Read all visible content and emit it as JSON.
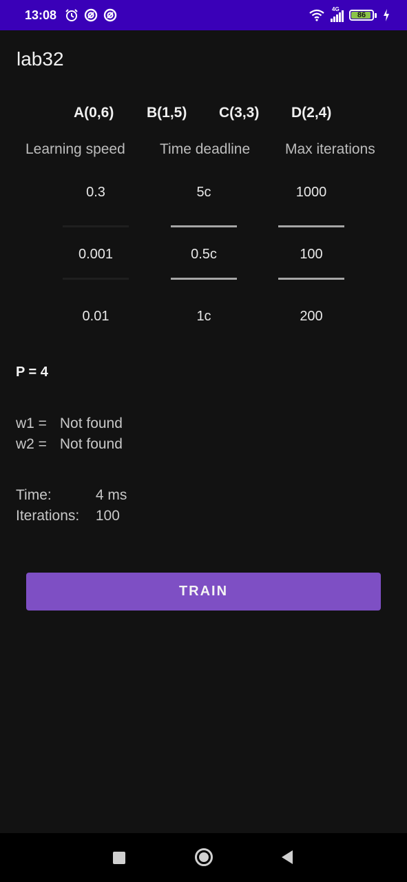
{
  "status_bar": {
    "time": "13:08",
    "icons_left": [
      "alarm-icon",
      "sync-icon",
      "sync-icon"
    ],
    "icons_right": [
      "wifi-icon",
      "signal-icon",
      "battery-icon",
      "charging-icon"
    ],
    "network": "4G",
    "battery": "86",
    "background": "#3a00b8"
  },
  "app": {
    "title": "lab32"
  },
  "points": [
    "A(0,6)",
    "B(1,5)",
    "C(3,3)",
    "D(2,4)"
  ],
  "columns": [
    {
      "header": "Learning speed",
      "values": [
        "0.3",
        "0.001",
        "0.01"
      ],
      "selected": "0.001"
    },
    {
      "header": "Time deadline",
      "values": [
        "5c",
        "0.5c",
        "1c"
      ],
      "selected": "0.5c"
    },
    {
      "header": "Max iterations",
      "values": [
        "1000",
        "100",
        "200"
      ],
      "selected": "100"
    }
  ],
  "p": {
    "label": "P = 4"
  },
  "results": {
    "w1_label": "w1 =",
    "w1_value": "Not found",
    "w2_label": "w2 =",
    "w2_value": "Not found",
    "time_label": "Time:",
    "time_value": "4 ms",
    "iterations_label": "Iterations:",
    "iterations_value": "100"
  },
  "train_button": {
    "label": "TRAIN",
    "color": "#7e4fc4"
  },
  "nav": [
    "recents-icon",
    "home-icon",
    "back-icon"
  ]
}
